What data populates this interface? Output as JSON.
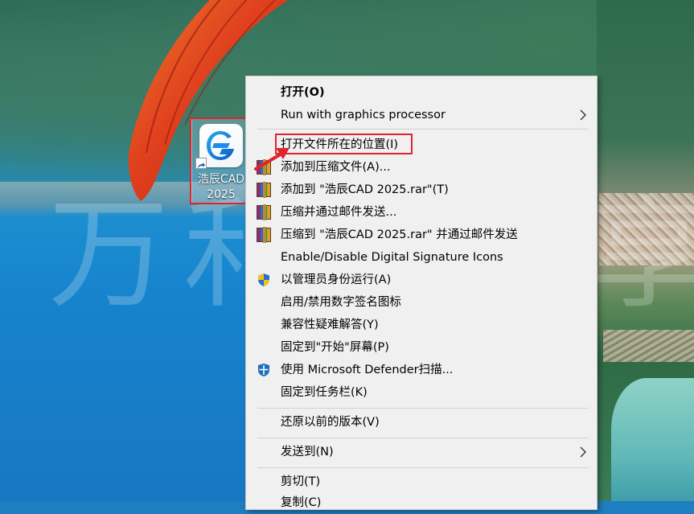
{
  "desktop": {
    "watermark": "万和天共享",
    "icon": {
      "label_line1": "浩辰CAD",
      "label_line2": "2025",
      "icon_name": "gstarcad-app-icon"
    }
  },
  "context_menu": {
    "items": [
      {
        "label": "打开(O)",
        "bold": true
      },
      {
        "label": "Run with graphics processor",
        "submenu": true
      },
      {
        "label": "打开文件所在的位置(I)",
        "highlighted": true
      },
      {
        "label": "添加到压缩文件(A)...",
        "icon": "winrar-icon"
      },
      {
        "label": "添加到 \"浩辰CAD 2025.rar\"(T)",
        "icon": "winrar-icon"
      },
      {
        "label": "压缩并通过邮件发送...",
        "icon": "winrar-icon"
      },
      {
        "label": "压缩到 \"浩辰CAD 2025.rar\" 并通过邮件发送",
        "icon": "winrar-icon"
      },
      {
        "label": "Enable/Disable Digital Signature Icons"
      },
      {
        "label": "以管理员身份运行(A)",
        "icon": "uac-shield-icon"
      },
      {
        "label": "启用/禁用数字签名图标"
      },
      {
        "label": "兼容性疑难解答(Y)"
      },
      {
        "label": "固定到\"开始\"屏幕(P)"
      },
      {
        "label": "使用 Microsoft Defender扫描...",
        "icon": "defender-icon"
      },
      {
        "label": "固定到任务栏(K)"
      },
      {
        "label": "还原以前的版本(V)"
      },
      {
        "label": "发送到(N)",
        "submenu": true
      },
      {
        "label": "剪切(T)"
      },
      {
        "label": "复制(C)"
      }
    ]
  },
  "colors": {
    "highlight_box": "#e0242b",
    "menu_background": "#f0f0f0"
  }
}
